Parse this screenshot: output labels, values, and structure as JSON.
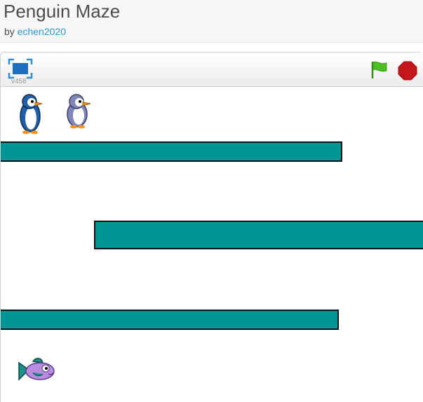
{
  "project": {
    "title": "Penguin Maze",
    "by_prefix": "by ",
    "author": "echen2020"
  },
  "player": {
    "version": "v458",
    "icons": {
      "fullscreen": "fullscreen-icon",
      "green_flag": "green-flag-icon",
      "stop": "stop-icon"
    },
    "colors": {
      "fullscreen_icon": "#1e6fbf",
      "green_flag": "#4cbf23",
      "stop": "#c4171b"
    }
  },
  "stage": {
    "wall_color": "#009696",
    "sprites": [
      "penguin-blue",
      "penguin-gray",
      "fish"
    ]
  }
}
